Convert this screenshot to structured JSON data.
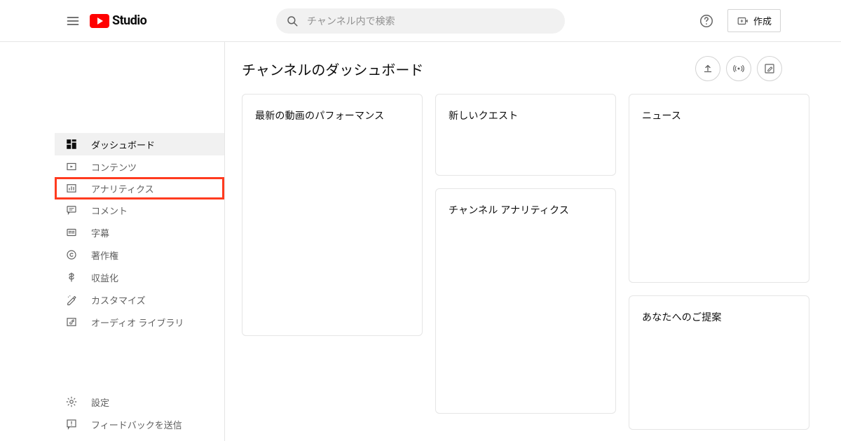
{
  "header": {
    "logo_text": "Studio",
    "search_placeholder": "チャンネル内で検索",
    "create_label": "作成"
  },
  "sidebar": {
    "items": [
      {
        "label": "ダッシュボード"
      },
      {
        "label": "コンテンツ"
      },
      {
        "label": "アナリティクス"
      },
      {
        "label": "コメント"
      },
      {
        "label": "字幕"
      },
      {
        "label": "著作権"
      },
      {
        "label": "収益化"
      },
      {
        "label": "カスタマイズ"
      },
      {
        "label": "オーディオ ライブラリ"
      }
    ],
    "bottom": [
      {
        "label": "設定"
      },
      {
        "label": "フィードバックを送信"
      }
    ]
  },
  "main": {
    "title": "チャンネルのダッシュボード",
    "cards": {
      "performance": "最新の動画のパフォーマンス",
      "quest": "新しいクエスト",
      "analytics": "チャンネル アナリティクス",
      "news": "ニュース",
      "suggestions": "あなたへのご提案"
    }
  }
}
